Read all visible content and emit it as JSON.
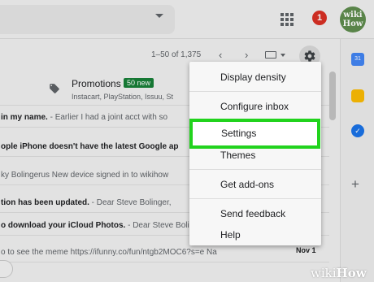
{
  "header": {
    "notification_count": "1",
    "avatar_text_line1": "wiki",
    "avatar_text_line2": "How"
  },
  "toolbar": {
    "pager": "1–50 of 1,375",
    "prev_icon": "chevron-left-icon",
    "next_icon": "chevron-right-icon",
    "keyboard_icon": "keyboard-icon",
    "settings_icon": "gear-icon"
  },
  "promotions": {
    "title": "Promotions",
    "badge": "50 new",
    "senders": "Instacart, PlayStation, Issuu, St"
  },
  "rows": [
    {
      "bold": "in my name.",
      "snippet": " - Earlier I had a joint acct with so"
    },
    {
      "bold": "ople iPhone doesn't have the latest Google ap",
      "snippet": ""
    },
    {
      "bold": "",
      "snippet": "ky Bolingerus New device signed in to wikihow"
    },
    {
      "bold": "tion has been updated.",
      "snippet": " -  Dear Steve Bolinger,"
    },
    {
      "bold": "o download your iCloud Photos.",
      "snippet": " -  Dear Steve Bolinger,"
    },
    {
      "bold": "",
      "snippet": "o to see the meme https://ifunny.co/fun/ntgb2MOC6?s=e Na"
    }
  ],
  "last_row_date": "Nov 1",
  "menu": {
    "items": [
      "Display density",
      "Configure inbox",
      "Settings",
      "Themes",
      "Get add-ons",
      "Send feedback",
      "Help"
    ]
  },
  "side_icons": [
    "calendar-icon",
    "keep-icon",
    "tasks-icon",
    "add-icon"
  ],
  "side_add_label": "+",
  "watermark": {
    "part1": "wiki",
    "part2": "How"
  },
  "colors": {
    "highlight": "#21d31d",
    "badge_green": "#188038",
    "notif_red": "#d93025"
  }
}
